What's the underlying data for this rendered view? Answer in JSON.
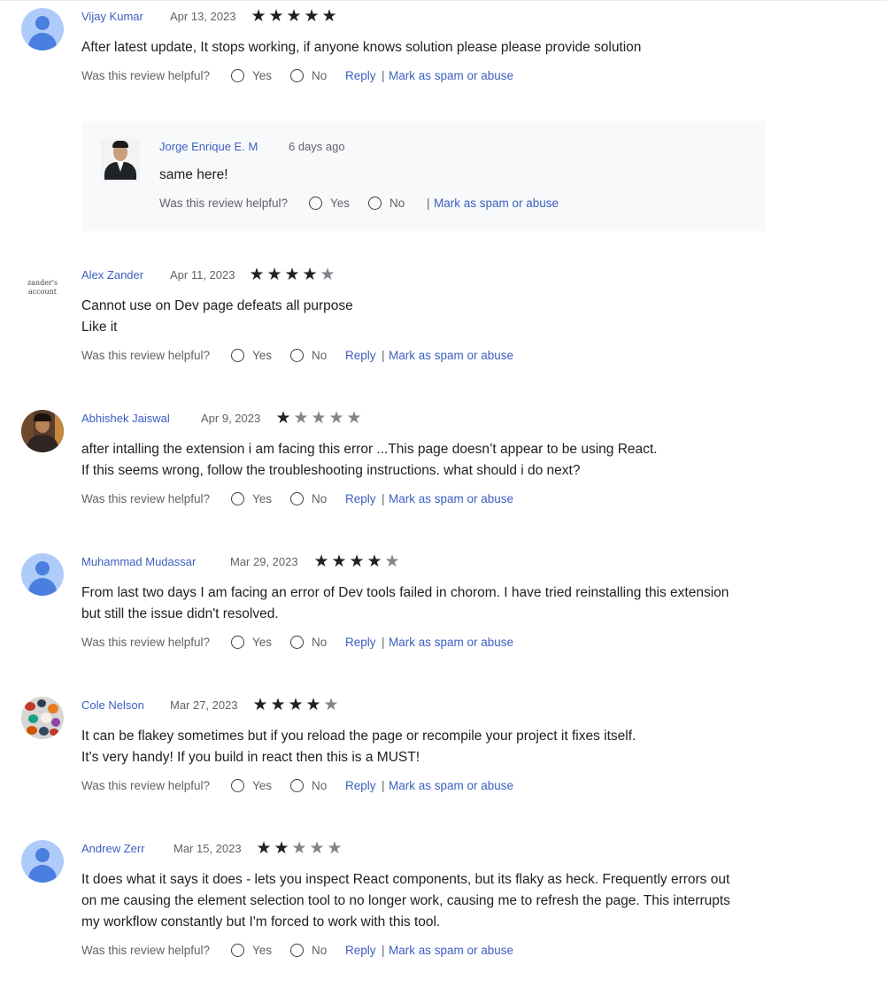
{
  "helpful_prompt": "Was this review helpful?",
  "yes_label": "Yes",
  "no_label": "No",
  "reply_label": "Reply",
  "separator": "|",
  "spam_label": "Mark as spam or abuse",
  "colors": {
    "link": "#3b5fc0",
    "star_on": "#202124",
    "star_off": "#80868b",
    "reply_bg": "#f8f9fa"
  },
  "reviews": [
    {
      "author": "Vijay Kumar",
      "date": "Apr 13, 2023",
      "rating": 5,
      "avatar": "default-user-icon",
      "lines": [
        "After latest update, It stops working, if anyone knows solution please please provide solution"
      ]
    },
    {
      "author": "Alex Zander",
      "date": "Apr 11, 2023",
      "rating": 4,
      "avatar": "text-avatar",
      "avatar_text": "zander's account",
      "lines": [
        "Cannot use on Dev page defeats all purpose",
        "Like it"
      ]
    },
    {
      "author": "Abhishek Jaiswal",
      "date": "Apr 9, 2023",
      "rating": 1,
      "avatar": "photo",
      "lines": [
        "after intalling the extension i am facing this error ...This page doesn’t appear to be using React.",
        "If this seems wrong, follow the troubleshooting instructions. what should i do next?"
      ]
    },
    {
      "author": "Muhammad Mudassar",
      "date": "Mar 29, 2023",
      "rating": 4,
      "avatar": "default-user-icon",
      "lines": [
        "From last two days I am facing an error of Dev tools failed in chorom. I have tried reinstalling this extension",
        "but still the issue didn't resolved."
      ]
    },
    {
      "author": "Cole Nelson",
      "date": "Mar 27, 2023",
      "rating": 4,
      "avatar": "photo",
      "lines": [
        "It can be flakey sometimes but if you reload the page or recompile your project it fixes itself.",
        "It's very handy! If you build in react then this is a MUST!"
      ]
    },
    {
      "author": "Andrew Zerr",
      "date": "Mar 15, 2023",
      "rating": 2,
      "avatar": "default-user-icon",
      "lines": [
        "It does what it says it does - lets you inspect React components, but its flaky as heck. Frequently errors out",
        "on me causing the element selection tool to no longer work, causing me to refresh the page. This interrupts",
        "my workflow constantly but I'm forced to work with this tool."
      ]
    }
  ],
  "reply": {
    "author": "Jorge Enrique E. M",
    "date": "6 days ago",
    "text": "same here!",
    "avatar": "photo"
  }
}
